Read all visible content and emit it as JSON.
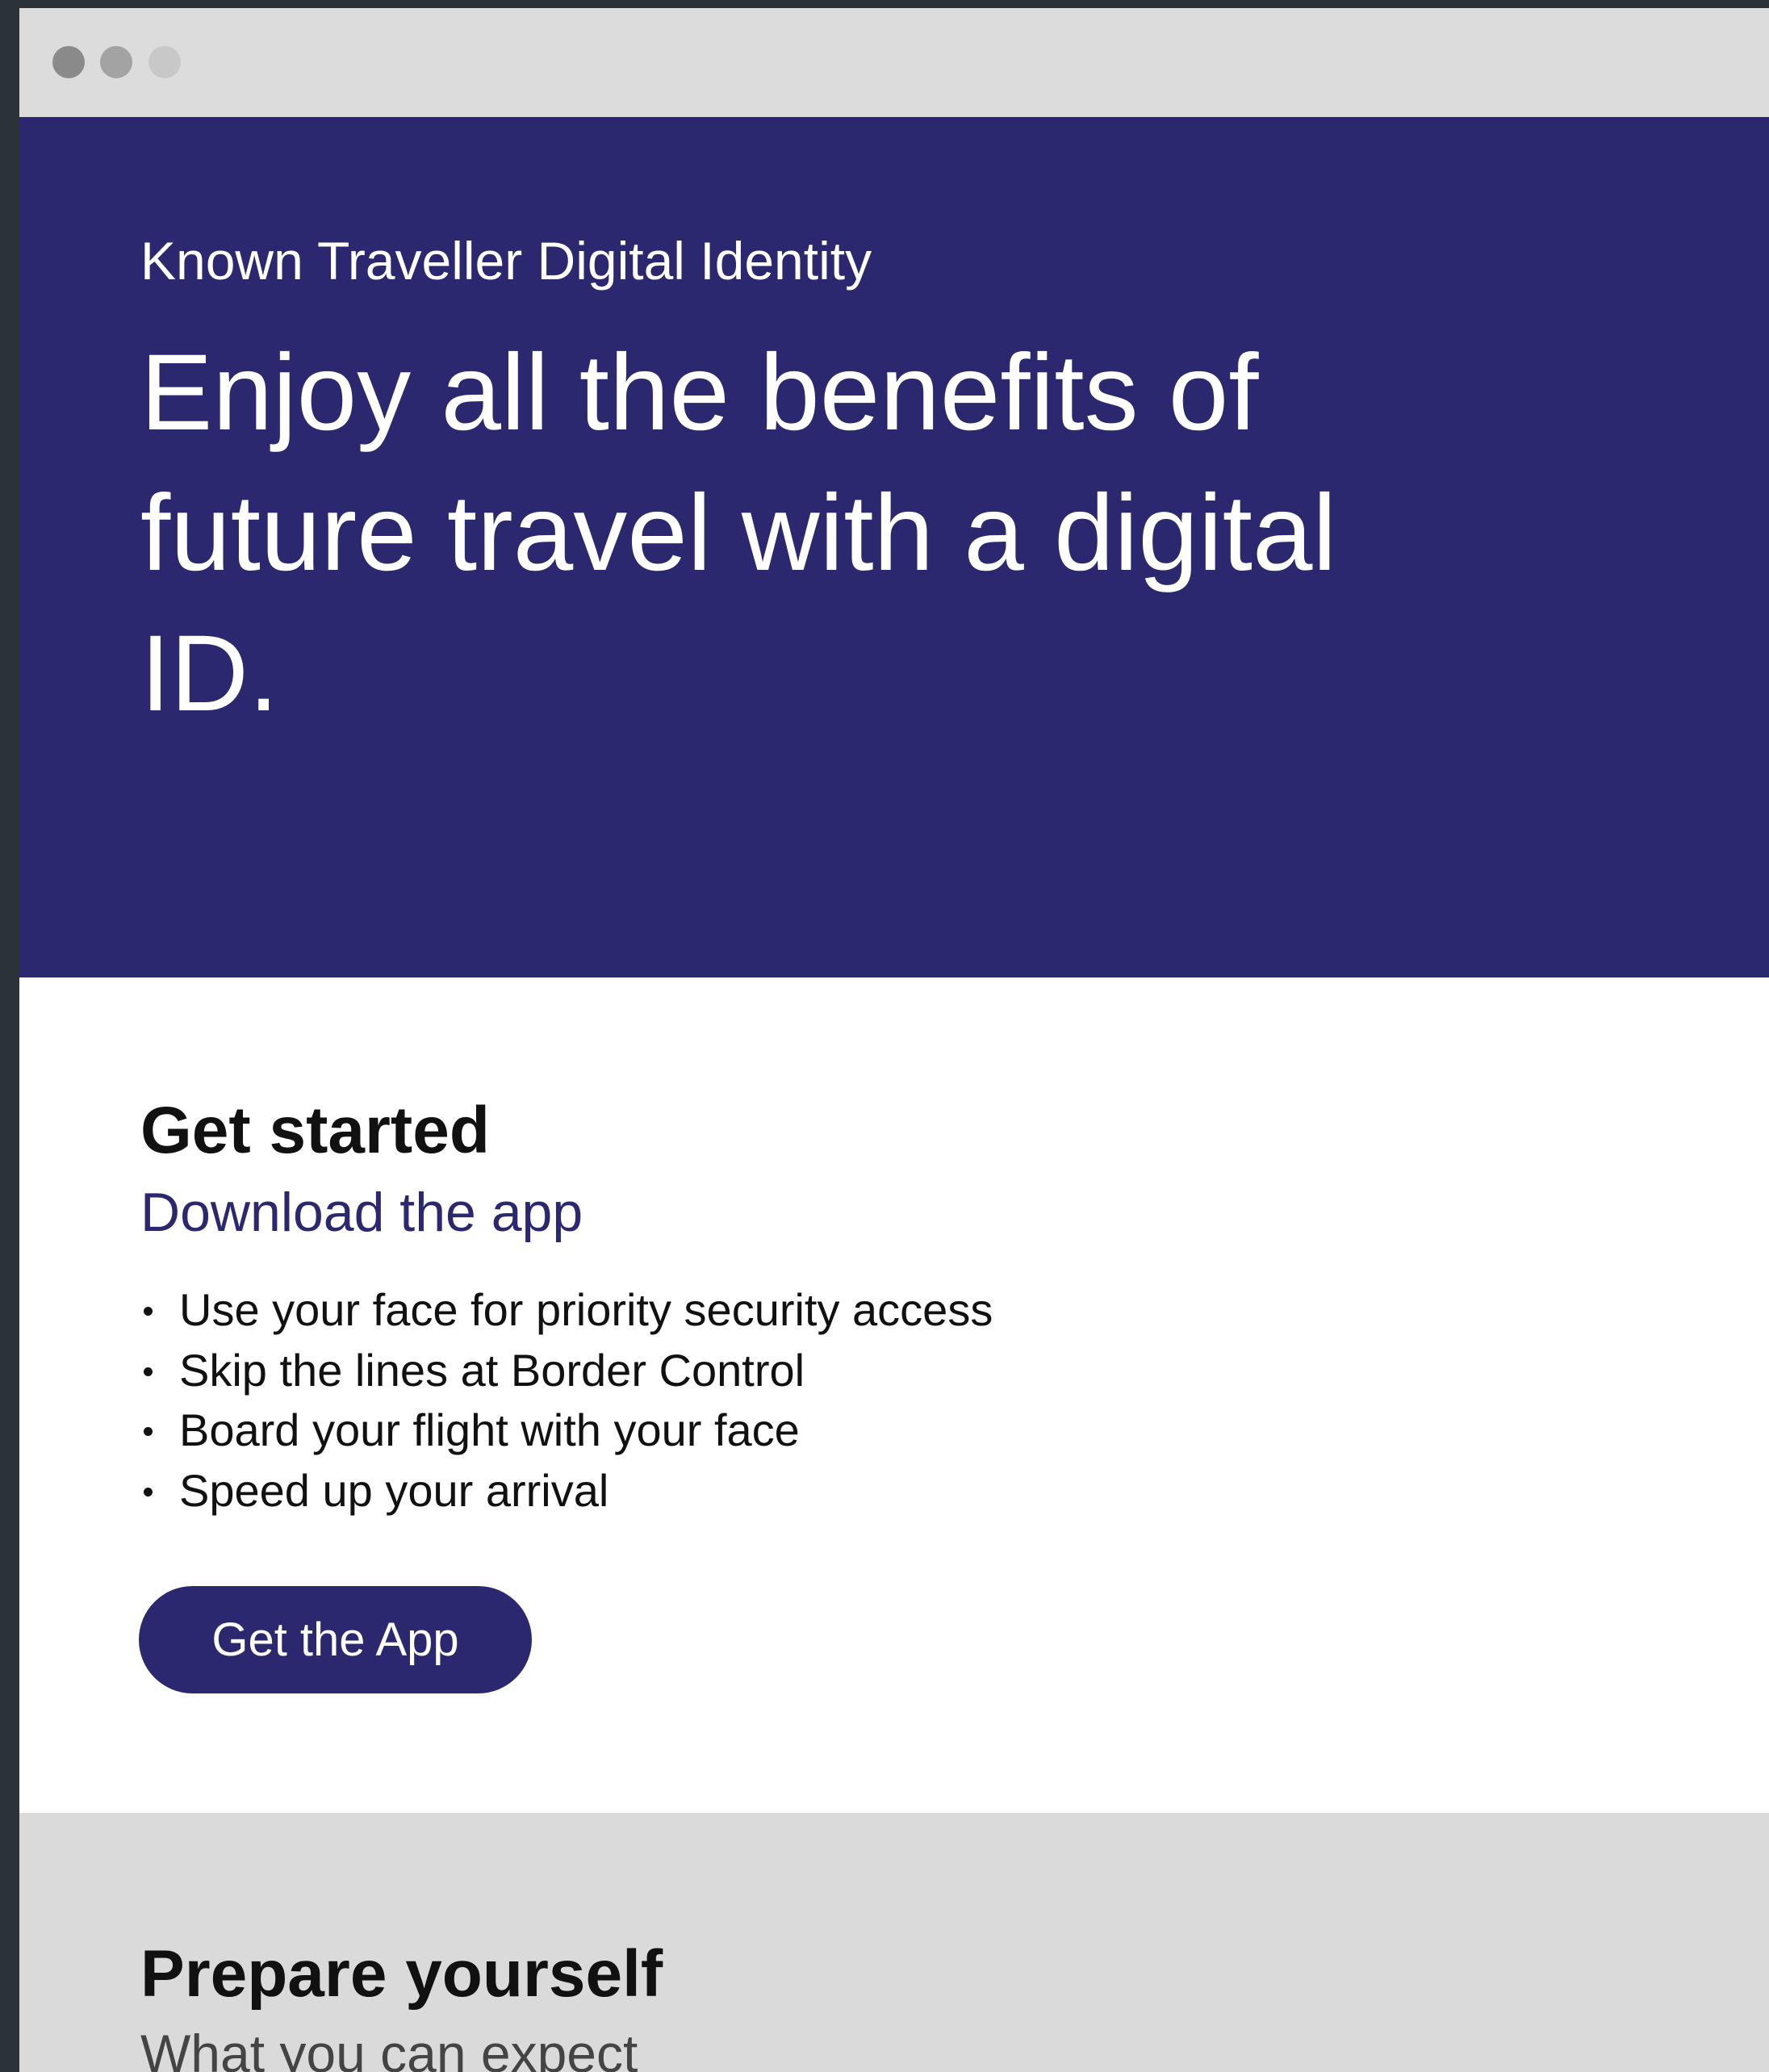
{
  "hero": {
    "eyebrow": "Known Traveller Digital Identity",
    "headline": "Enjoy all the benefits of future travel with a digital ID."
  },
  "get_started": {
    "title": "Get started",
    "subtitle": "Download the app",
    "benefits": [
      "Use your face for priority security access",
      "Skip the lines at Border Control",
      "Board your flight with your face",
      "Speed up your arrival"
    ],
    "button_label": "Get the App"
  },
  "prepare": {
    "title": "Prepare yourself",
    "subtitle": "What you can expect"
  },
  "colors": {
    "brand_navy": "#2c2870",
    "titlebar": "#dcdcdc",
    "prepare_bg": "#dadada"
  }
}
